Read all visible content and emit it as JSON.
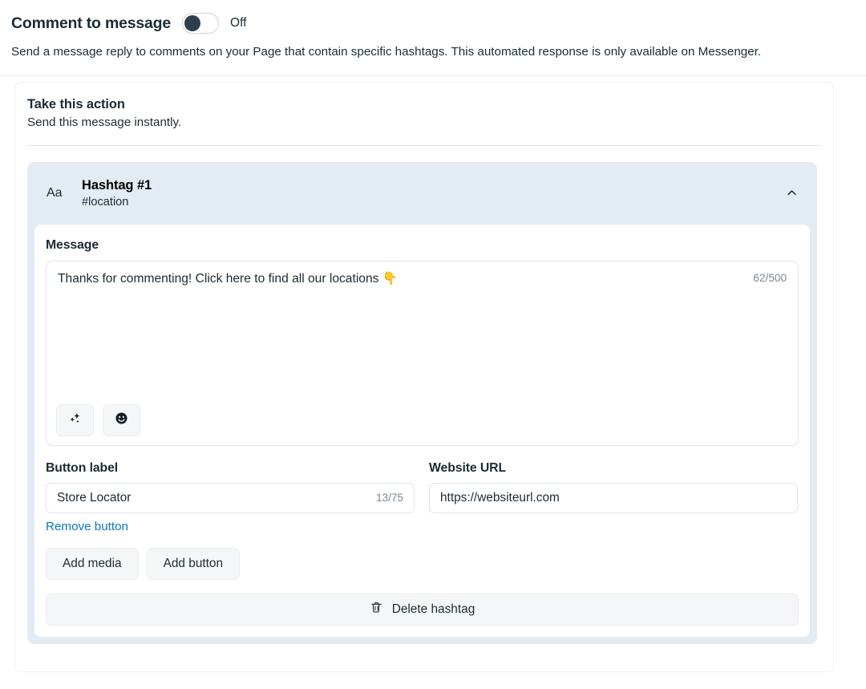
{
  "header": {
    "title": "Comment to message",
    "toggle_state": "Off",
    "toggle_on": false,
    "description": "Send a message reply to comments on your Page that contain specific hashtags. This automated response is only available on Messenger."
  },
  "action_section": {
    "title": "Take this action",
    "subtitle": "Send this message instantly."
  },
  "hashtag_card": {
    "type_icon_label": "Aa",
    "name": "Hashtag #1",
    "tag": "#location",
    "collapse_icon": "chevron-up-icon",
    "message": {
      "label": "Message",
      "value": "Thanks for commenting! Click here to find all our locations 👇",
      "char_count": "62/500",
      "tools": [
        {
          "name": "ai-sparkles-icon",
          "glyph": "sparkles"
        },
        {
          "name": "emoji-picker-icon",
          "glyph": "smiley"
        }
      ]
    },
    "button_label_field": {
      "label": "Button label",
      "value": "Store Locator",
      "char_count": "13/75",
      "remove_link": "Remove button"
    },
    "website_url_field": {
      "label": "Website URL",
      "value": "https://websiteurl.com"
    },
    "actions": [
      {
        "label": "Add media",
        "name": "add-media-button"
      },
      {
        "label": "Add button",
        "name": "add-button-button"
      }
    ],
    "delete": {
      "label": "Delete hashtag",
      "icon": "trash-icon"
    }
  },
  "colors": {
    "hashtag_card_bg": "#e3ebf3",
    "link": "#0a78be",
    "toggle_knob": "#2d3f4f",
    "text": "#1c2b33"
  }
}
